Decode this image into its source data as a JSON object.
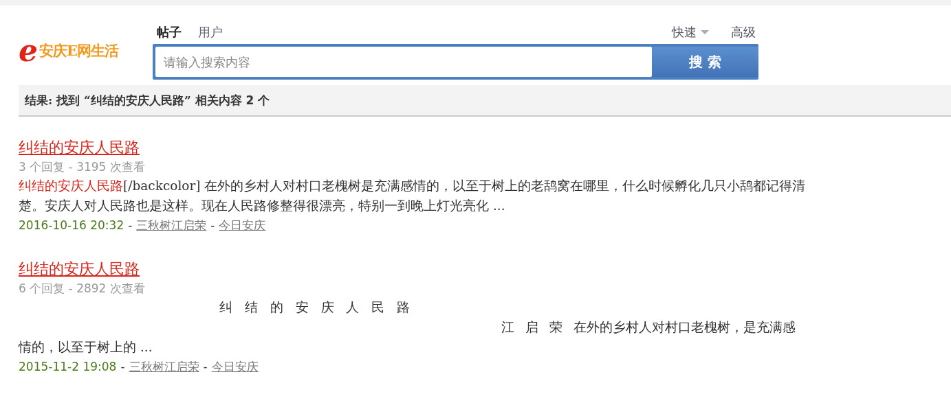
{
  "logo": {
    "mark": "e",
    "text": "安庆E网生活"
  },
  "search_tabs": [
    {
      "label": "帖子",
      "selected": true
    },
    {
      "label": "用户",
      "selected": false
    }
  ],
  "search_options": [
    {
      "label": "快速",
      "kind": "dropdown"
    },
    {
      "label": "高级",
      "kind": "link"
    }
  ],
  "search": {
    "placeholder": "请输入搜索内容",
    "button": "搜 索"
  },
  "summary": {
    "prefix": "结果: 找到 “纠结的安庆人民路” 相关内容",
    "count": "2",
    "suffix": "个"
  },
  "results": [
    {
      "title": "纠结的安庆人民路",
      "stats": "3 个回复 - 3195 次查看",
      "excerpt": [
        {
          "kind": "plain",
          "segments": [
            {
              "text": "纠结的安庆人民路",
              "highlight": true
            },
            {
              "text": "[/backcolor] 在外的乡村人对村口老槐树是充满感情的，以至于树上的老鸹窝在哪里，什么时候孵化几只小鸹都记得清楚。安庆人对人民路也是这样。现在人民路修整得很漂亮，特别一到晚上灯光亮化 ...",
              "highlight": false
            }
          ]
        }
      ],
      "date": "2016-10-16 20:32",
      "separator_1": "-",
      "author": "三秋树江启荣",
      "separator_2": "-",
      "forum": "今日安庆"
    },
    {
      "title": "纠结的安庆人民路",
      "stats": "6 个回复 - 2892 次查看",
      "excerpt": [
        {
          "kind": "centered",
          "segments": [
            {
              "text": "纠 结 的 安 庆 人 民 路",
              "highlight": false
            }
          ]
        },
        {
          "kind": "indented",
          "segments": [
            {
              "text": "江 启 荣 在外的乡村人对村口老槐树，是充满感",
              "highlight": false
            }
          ]
        },
        {
          "kind": "plain",
          "segments": [
            {
              "text": "情的，以至于树上的 ...",
              "highlight": false
            }
          ]
        }
      ],
      "date": "2015-11-2 19:08",
      "separator_1": "-",
      "author": "三秋树江启荣",
      "separator_2": "-",
      "forum": "今日安庆"
    }
  ]
}
